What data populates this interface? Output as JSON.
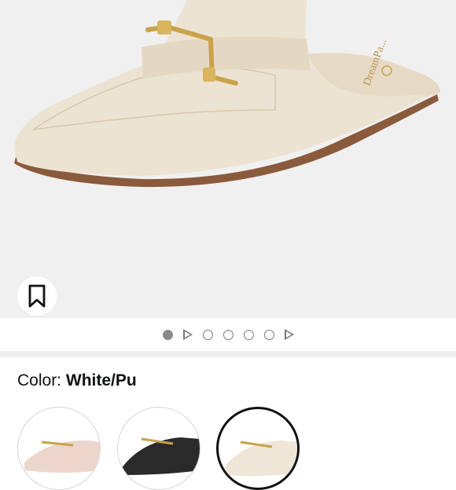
{
  "product": {
    "image_alt": "White/Pu pointed toe mule with gold horsebit buckle",
    "insole_brand": "DreamPa..."
  },
  "actions": {
    "save_icon": "bookmark-icon"
  },
  "carousel": {
    "items": [
      "image",
      "video",
      "image",
      "image",
      "image",
      "image",
      "video"
    ],
    "active_index": 0
  },
  "color_selector": {
    "label": "Color:",
    "value": "White/Pu",
    "options": [
      {
        "name": "Pink",
        "fill": "#ecd6cc"
      },
      {
        "name": "Black",
        "fill": "#2a2a2a"
      },
      {
        "name": "White/Pu",
        "fill": "#efe6d8"
      }
    ],
    "selected_index": 2
  },
  "colors": {
    "hero_bg": "#f0f0f0",
    "shoe_upper": "#ede3d3",
    "buckle_gold": "#c9a24a",
    "sole_brown": "#8a5a3c"
  }
}
